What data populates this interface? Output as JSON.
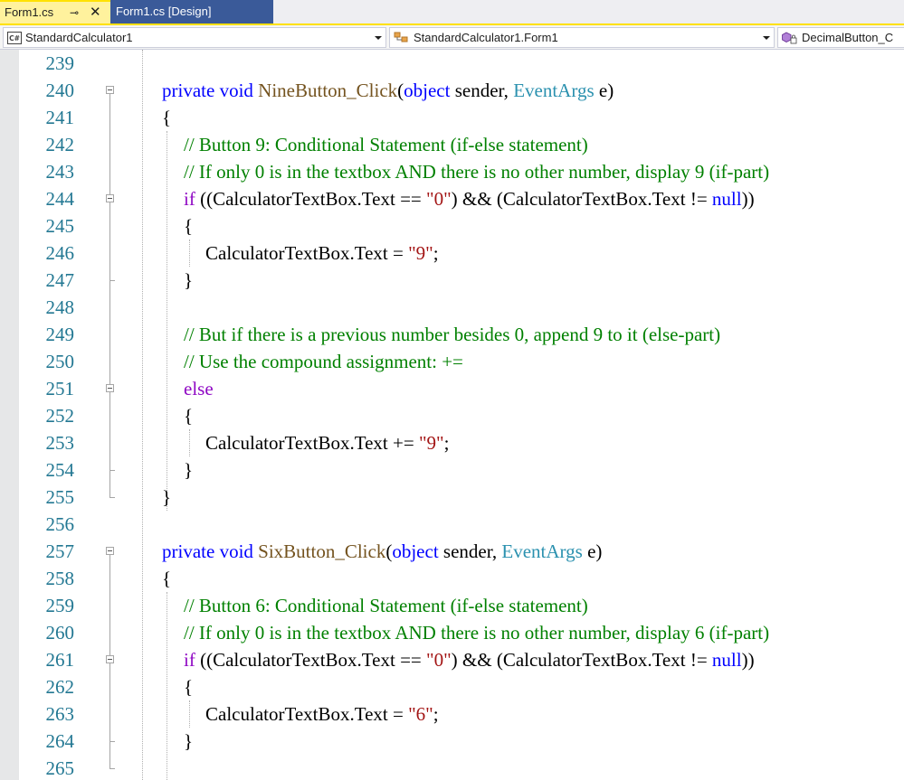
{
  "tabs": [
    {
      "label": "Form1.cs",
      "active": true,
      "pin_glyph": "⊸",
      "close_glyph": "✕"
    },
    {
      "label": "Form1.cs [Design]",
      "active": false
    }
  ],
  "navbar": {
    "project": {
      "icon": "C#",
      "label": "StandardCalculator1"
    },
    "class": {
      "label": "StandardCalculator1.Form1"
    },
    "member": {
      "label": "DecimalButton_C"
    }
  },
  "colors": {
    "active_tab": "#FFF29D",
    "active_tab_accent": "#FFE100",
    "inactive_tab": "#3A5A99",
    "line_number": "#237893",
    "keyword": "#0000FF",
    "control_keyword": "#8F08C4",
    "method": "#74531F",
    "type": "#2B91AF",
    "string": "#A31515",
    "comment": "#008000"
  },
  "editor": {
    "lines": [
      {
        "num": "239",
        "indent": 0,
        "tokens": []
      },
      {
        "num": "240",
        "indent": 0,
        "fold": true,
        "tokens": [
          {
            "t": "private",
            "c": "kw"
          },
          {
            "t": " "
          },
          {
            "t": "void",
            "c": "kw"
          },
          {
            "t": " "
          },
          {
            "t": "NineButton_Click",
            "c": "fn"
          },
          {
            "t": "("
          },
          {
            "t": "object",
            "c": "kw"
          },
          {
            "t": " sender, "
          },
          {
            "t": "EventArgs",
            "c": "ty"
          },
          {
            "t": " e)"
          }
        ]
      },
      {
        "num": "241",
        "indent": 0,
        "tokens": [
          {
            "t": "{"
          }
        ]
      },
      {
        "num": "242",
        "indent": 1,
        "tokens": [
          {
            "t": "// Button 9: Conditional Statement (if-else statement)",
            "c": "cm"
          }
        ]
      },
      {
        "num": "243",
        "indent": 1,
        "tokens": [
          {
            "t": "// If only 0 is in the textbox AND there is no other number, display 9 (if-part)",
            "c": "cm"
          }
        ]
      },
      {
        "num": "244",
        "indent": 1,
        "fold": true,
        "tokens": [
          {
            "t": "if",
            "c": "ctl"
          },
          {
            "t": " ((CalculatorTextBox.Text == "
          },
          {
            "t": "\"0\"",
            "c": "str"
          },
          {
            "t": ") && (CalculatorTextBox.Text != "
          },
          {
            "t": "null",
            "c": "kw"
          },
          {
            "t": "))"
          }
        ]
      },
      {
        "num": "245",
        "indent": 1,
        "tokens": [
          {
            "t": "{"
          }
        ]
      },
      {
        "num": "246",
        "indent": 2,
        "tokens": [
          {
            "t": "CalculatorTextBox.Text = "
          },
          {
            "t": "\"9\"",
            "c": "str"
          },
          {
            "t": ";"
          }
        ]
      },
      {
        "num": "247",
        "indent": 1,
        "tokens": [
          {
            "t": "}"
          }
        ]
      },
      {
        "num": "248",
        "indent": 0,
        "tokens": []
      },
      {
        "num": "249",
        "indent": 1,
        "tokens": [
          {
            "t": "// But if there is a previous number besides 0, append 9 to it (else-part)",
            "c": "cm"
          }
        ]
      },
      {
        "num": "250",
        "indent": 1,
        "tokens": [
          {
            "t": "// Use the compound assignment: +=",
            "c": "cm"
          }
        ]
      },
      {
        "num": "251",
        "indent": 1,
        "fold": true,
        "tokens": [
          {
            "t": "else",
            "c": "ctl"
          }
        ]
      },
      {
        "num": "252",
        "indent": 1,
        "tokens": [
          {
            "t": "{"
          }
        ]
      },
      {
        "num": "253",
        "indent": 2,
        "tokens": [
          {
            "t": "CalculatorTextBox.Text += "
          },
          {
            "t": "\"9\"",
            "c": "str"
          },
          {
            "t": ";"
          }
        ]
      },
      {
        "num": "254",
        "indent": 1,
        "tokens": [
          {
            "t": "}"
          }
        ]
      },
      {
        "num": "255",
        "indent": 0,
        "tokens": [
          {
            "t": "}"
          }
        ]
      },
      {
        "num": "256",
        "indent": 0,
        "tokens": []
      },
      {
        "num": "257",
        "indent": 0,
        "fold": true,
        "tokens": [
          {
            "t": "private",
            "c": "kw"
          },
          {
            "t": " "
          },
          {
            "t": "void",
            "c": "kw"
          },
          {
            "t": " "
          },
          {
            "t": "SixButton_Click",
            "c": "fn"
          },
          {
            "t": "("
          },
          {
            "t": "object",
            "c": "kw"
          },
          {
            "t": " sender, "
          },
          {
            "t": "EventArgs",
            "c": "ty"
          },
          {
            "t": " e)"
          }
        ]
      },
      {
        "num": "258",
        "indent": 0,
        "tokens": [
          {
            "t": "{"
          }
        ]
      },
      {
        "num": "259",
        "indent": 1,
        "tokens": [
          {
            "t": "// Button 6: Conditional Statement (if-else statement)",
            "c": "cm"
          }
        ]
      },
      {
        "num": "260",
        "indent": 1,
        "tokens": [
          {
            "t": "// If only 0 is in the textbox AND there is no other number, display 6 (if-part)",
            "c": "cm"
          }
        ]
      },
      {
        "num": "261",
        "indent": 1,
        "fold": true,
        "tokens": [
          {
            "t": "if",
            "c": "ctl"
          },
          {
            "t": " ((CalculatorTextBox.Text == "
          },
          {
            "t": "\"0\"",
            "c": "str"
          },
          {
            "t": ") && (CalculatorTextBox.Text != "
          },
          {
            "t": "null",
            "c": "kw"
          },
          {
            "t": "))"
          }
        ]
      },
      {
        "num": "262",
        "indent": 1,
        "tokens": [
          {
            "t": "{"
          }
        ]
      },
      {
        "num": "263",
        "indent": 2,
        "tokens": [
          {
            "t": "CalculatorTextBox.Text = "
          },
          {
            "t": "\"6\"",
            "c": "str"
          },
          {
            "t": ";"
          }
        ]
      },
      {
        "num": "264",
        "indent": 1,
        "tokens": [
          {
            "t": "}"
          }
        ]
      },
      {
        "num": "265",
        "indent": 0,
        "tokens": []
      }
    ]
  }
}
